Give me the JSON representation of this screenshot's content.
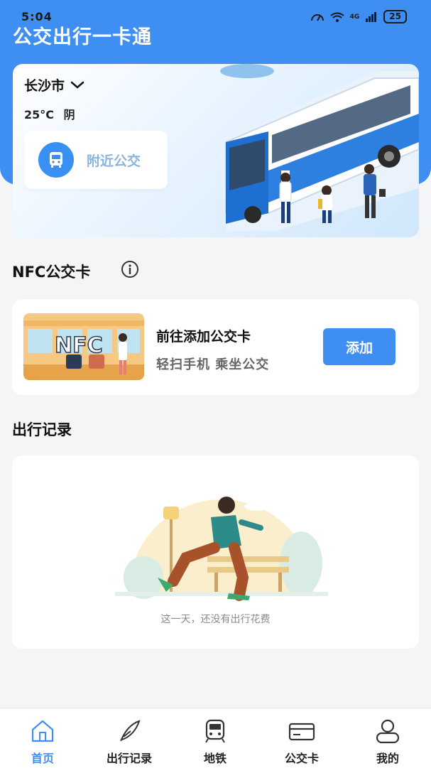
{
  "status_bar": {
    "time": "5:04",
    "network": "4G",
    "battery": "25"
  },
  "app_title": "公交出行一卡通",
  "location": {
    "city": "长沙市",
    "temperature": "25°C",
    "weather": "阴"
  },
  "nearby_bus": {
    "label": "附近公交",
    "icon": "bus-icon"
  },
  "nfc_section": {
    "title": "NFC公交卡",
    "card_title": "前往添加公交卡",
    "card_subtitle": "轻扫手机  乘坐公交",
    "add_button": "添加",
    "thumb_text": "NFC"
  },
  "records_section": {
    "title": "出行记录",
    "empty_text": "这一天，还没有出行花费"
  },
  "tabbar": {
    "items": [
      {
        "label": "首页",
        "icon": "home-icon",
        "active": true
      },
      {
        "label": "出行记录",
        "icon": "feather-icon",
        "active": false
      },
      {
        "label": "地铁",
        "icon": "metro-icon",
        "active": false
      },
      {
        "label": "公交卡",
        "icon": "card-icon",
        "active": false
      },
      {
        "label": "我的",
        "icon": "user-icon",
        "active": false
      }
    ]
  },
  "colors": {
    "primary": "#3f8ef2",
    "background": "#f4f5f7",
    "nearby_label": "#8ab4de"
  }
}
